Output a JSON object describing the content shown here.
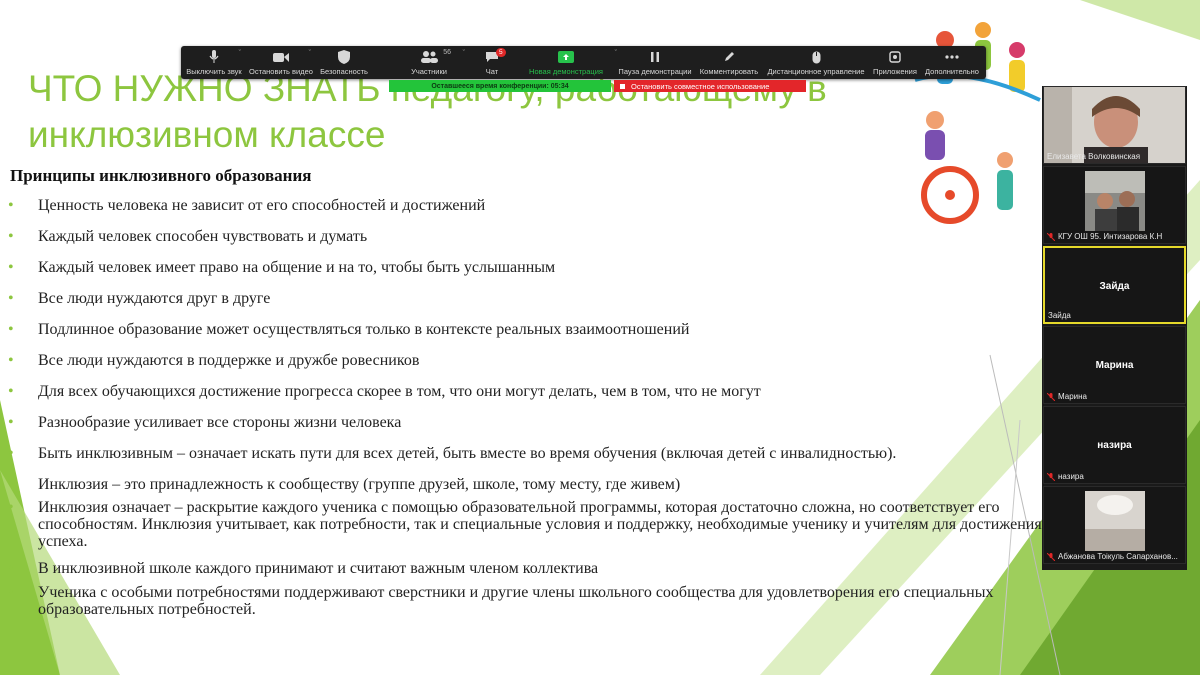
{
  "slide": {
    "title": "ЧТО НУЖНО ЗНАТЬ педагогу, работающему в инклюзивном классе",
    "principles_heading": "Принципы инклюзивного образования",
    "bullets": [
      "Ценность человека не зависит от его способностей и достижений",
      "Каждый человек способен чувствовать и думать",
      "Каждый человек имеет право на общение и на то, чтобы быть услышанным",
      "Все люди нуждаются друг в друге",
      "Подлинное образование может осуществляться только в контексте реальных взаимоотношений",
      "Все люди нуждаются в поддержке и дружбе ровесников",
      "Для всех обучающихся достижение прогресса скорее в том, что они могут делать, чем в том, что не могут",
      "Разнообразие усиливает все стороны жизни человека",
      "Быть инклюзивным – означает искать пути для всех детей, быть вместе во время обучения (включая детей с инвалидностью).",
      "Инклюзия – это принадлежность к сообществу (группе друзей, школе, тому месту, где живем)",
      "Инклюзия означает – раскрытие каждого ученика с помощью образовательной программы, которая достаточно сложна, но соответствует его способностям. Инклюзия учитывает, как потребности, так и специальные условия и поддержку, необходимые ученику и учителям для достижения успеха.",
      "В инклюзивной школе каждого принимают и считают важным членом коллектива",
      "Ученика с особыми потребностями поддерживают сверстники и другие члены школьного сообщества для удовлетворения его специальных образовательных потребностей."
    ],
    "accent_color": "#8dc63f"
  },
  "toolbar": {
    "mute": "Выключить звук",
    "video": "Остановить видео",
    "security": "Безопасность",
    "participants": "Участники",
    "participants_count": "56",
    "chat": "Чат",
    "chat_badge": "5",
    "new_share": "Новая демонстрация",
    "pause_share": "Пауза демонстрации",
    "annotate": "Комментировать",
    "remote_control": "Дистанционное управление",
    "apps": "Приложения",
    "more": "Дополнительно"
  },
  "timer_label": "Оставшееся время конференции: 05:34",
  "stop_share_label": "Остановить совместное использование",
  "participants": [
    {
      "name": "Елизавета Волковинская",
      "center": "",
      "video": true,
      "muted": false
    },
    {
      "name": "КГУ ОШ 95. Интизарова К.Н",
      "center": "",
      "video": true,
      "muted": true
    },
    {
      "name": "Зайда",
      "center": "Зайда",
      "video": false,
      "muted": false,
      "active": true
    },
    {
      "name": "Марина",
      "center": "Марина",
      "video": false,
      "muted": true
    },
    {
      "name": "назира",
      "center": "назира",
      "video": false,
      "muted": true
    },
    {
      "name": "Абжанова Тоікуль Сапарханов...",
      "center": "",
      "video": true,
      "muted": true
    }
  ]
}
